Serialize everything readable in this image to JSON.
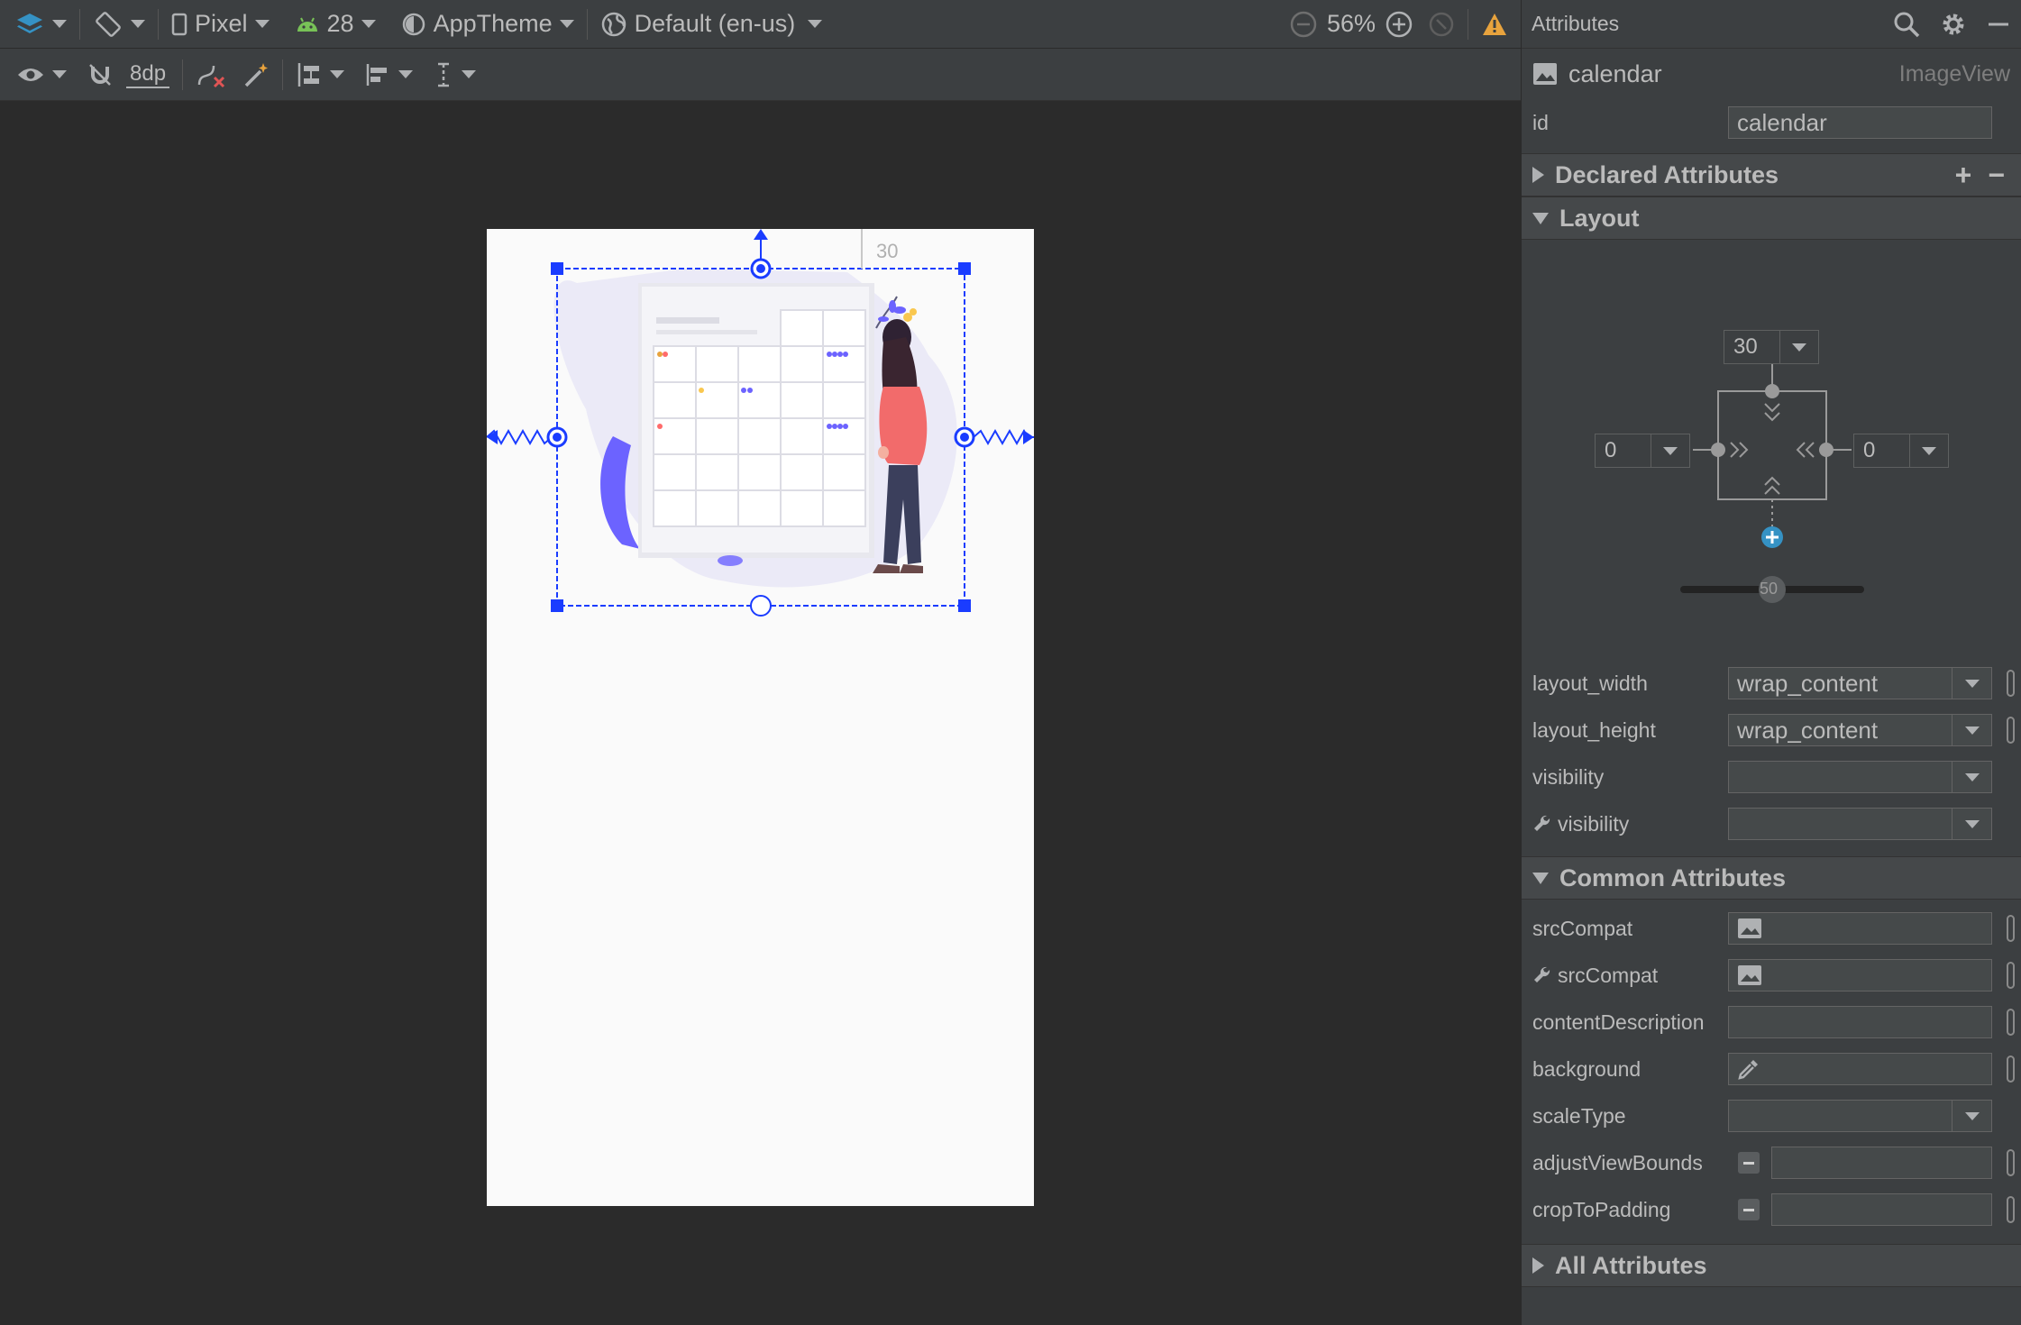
{
  "toolbar": {
    "device": "Pixel",
    "api_level": "28",
    "theme": "AppTheme",
    "locale": "Default (en-us)",
    "zoom": "56%",
    "margin_default": "8dp"
  },
  "canvas": {
    "top_margin_label": "30"
  },
  "panel": {
    "title": "Attributes",
    "component_name": "calendar",
    "component_class": "ImageView",
    "id_label": "id",
    "id_value": "calendar",
    "sections": {
      "declared": "Declared Attributes",
      "layout": "Layout",
      "common": "Common Attributes",
      "all": "All Attributes"
    },
    "constraint": {
      "top": "30",
      "left": "0",
      "right": "0",
      "bias": "50"
    },
    "layout_attrs": [
      {
        "label": "layout_width",
        "value": "wrap_content"
      },
      {
        "label": "layout_height",
        "value": "wrap_content"
      },
      {
        "label": "visibility",
        "value": ""
      },
      {
        "label": "visibility",
        "value": ""
      }
    ],
    "common_attrs": [
      {
        "label": "srcCompat"
      },
      {
        "label": "srcCompat"
      },
      {
        "label": "contentDescription"
      },
      {
        "label": "background"
      },
      {
        "label": "scaleType"
      },
      {
        "label": "adjustViewBounds"
      },
      {
        "label": "cropToPadding"
      }
    ]
  },
  "colors": {
    "selection": "#1a3cff",
    "accent_purple": "#6c63ff",
    "warning": "#e8a33d",
    "panel_bg": "#3c3f41",
    "canvas_bg": "#2b2b2b"
  }
}
